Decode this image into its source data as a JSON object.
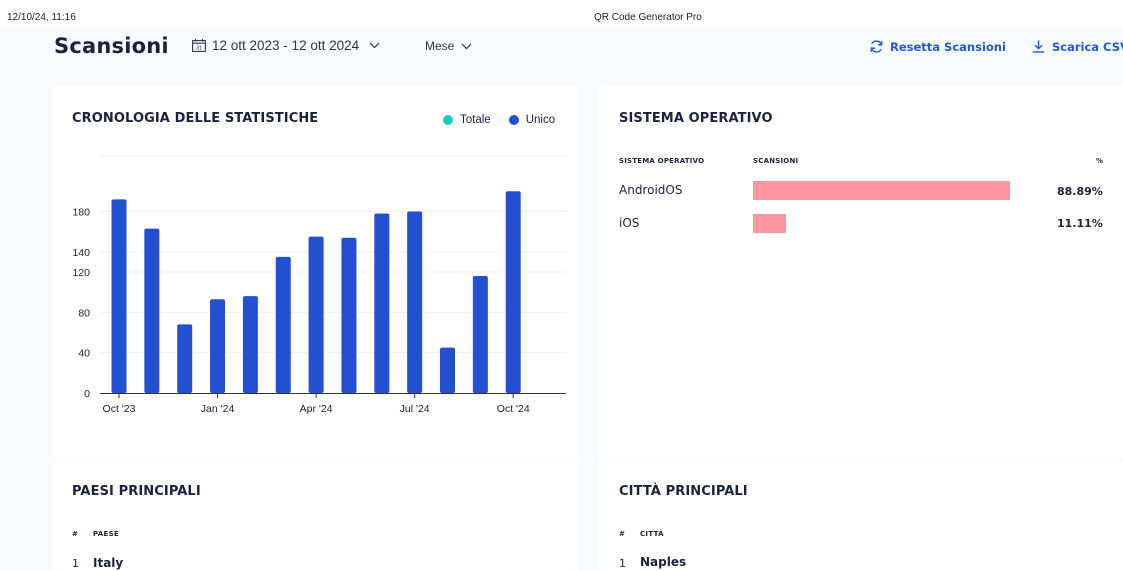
{
  "print_header": {
    "datetime": "12/10/24, 11:16",
    "title": "QR Code Generator Pro"
  },
  "header": {
    "title": "Scansioni",
    "date_range": "12 ott 2023 - 12 ott 2024",
    "calendar_icon": "calendar-icon",
    "period": "Mese",
    "reset_label": "Resetta Scansioni",
    "download_label": "Scarica CSV",
    "accent_color": "#2458d8"
  },
  "stats_card": {
    "title": "CRONOLOGIA DELLE STATISTICHE",
    "legend": [
      {
        "label": "Totale",
        "color": "#1ec8c0"
      },
      {
        "label": "Unico",
        "color": "#2350d0"
      }
    ]
  },
  "chart_data": {
    "type": "bar",
    "x": [
      "2023-10",
      "2023-11",
      "2023-12",
      "2024-01",
      "2024-02",
      "2024-03",
      "2024-04",
      "2024-05",
      "2024-06",
      "2024-07",
      "2024-08",
      "2024-09",
      "2024-10"
    ],
    "x_tick_labels": [
      {
        "x": "2023-10",
        "label": "Oct '23"
      },
      {
        "x": "2024-01",
        "label": "Jan '24"
      },
      {
        "x": "2024-04",
        "label": "Apr '24"
      },
      {
        "x": "2024-07",
        "label": "Jul '24"
      },
      {
        "x": "2024-10",
        "label": "Oct '24"
      }
    ],
    "series": [
      {
        "name": "Unico",
        "color": "#2350d0",
        "values": [
          192,
          163,
          68,
          93,
          96,
          135,
          155,
          154,
          178,
          180,
          45,
          116,
          200
        ]
      }
    ],
    "y_ticks": [
      0,
      40,
      80,
      120,
      140,
      180
    ],
    "ylim": [
      0,
      235
    ],
    "grid": true,
    "legend": "top-right"
  },
  "os_card": {
    "title": "SISTEMA OPERATIVO",
    "columns": [
      "SISTEMA OPERATIVO",
      "SCANSIONI",
      "%"
    ],
    "bar_color": "#ff959d",
    "rows": [
      {
        "name": "AndroidOS",
        "percent_label": "88.89%",
        "share": 0.8889
      },
      {
        "name": "iOS",
        "percent_label": "11.11%",
        "share": 0.1111
      }
    ]
  },
  "countries_card": {
    "title": "PAESI PRINCIPALI",
    "columns": [
      "#",
      "PAESE"
    ],
    "rows": [
      {
        "rank": "1",
        "name": "Italy"
      }
    ]
  },
  "cities_card": {
    "title": "CITTÀ PRINCIPALI",
    "columns": [
      "#",
      "CITTÀ"
    ],
    "rows": [
      {
        "rank": "1",
        "name": "Naples"
      }
    ]
  }
}
